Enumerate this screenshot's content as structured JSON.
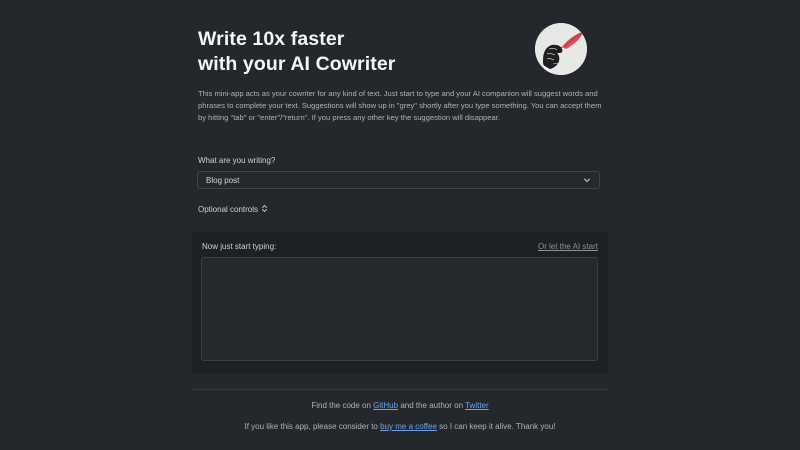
{
  "header": {
    "title_line1": "Write 10x faster",
    "title_line2": "with your AI Cowriter"
  },
  "logo": {
    "icon": "hand-holding-quill-icon"
  },
  "intro": {
    "text": "This mini-app acts as your cowriter for any kind of text. Just start to type and your AI companion will suggest words and phrases to complete your text. Suggestions will show up in \"grey\" shortly after you type something. You can accept them by hitting \"tab\" or \"enter\"/\"return\". If you press any other key the suggestion will disappear."
  },
  "writing_type": {
    "label": "What are you writing?",
    "selected": "Blog post"
  },
  "optional_controls": {
    "label": "Optional controls",
    "icon": "chevron-up-down-icon"
  },
  "editor": {
    "label": "Now just start typing:",
    "ai_start_link": "Or let the AI start",
    "value": ""
  },
  "footer": {
    "line1_before": "Find the code on",
    "github_link": "GitHub",
    "line1_middle": "and the author on",
    "twitter_link": "Twitter",
    "line2_before": "If you like this app, please consider to",
    "coffee_link": "buy me a coffee",
    "line2_after": "so I can keep it alive. Thank you!"
  },
  "colors": {
    "background": "#24282c",
    "panel": "#1d2024",
    "link": "#6aa5ea",
    "title": "#f4f5f6"
  }
}
